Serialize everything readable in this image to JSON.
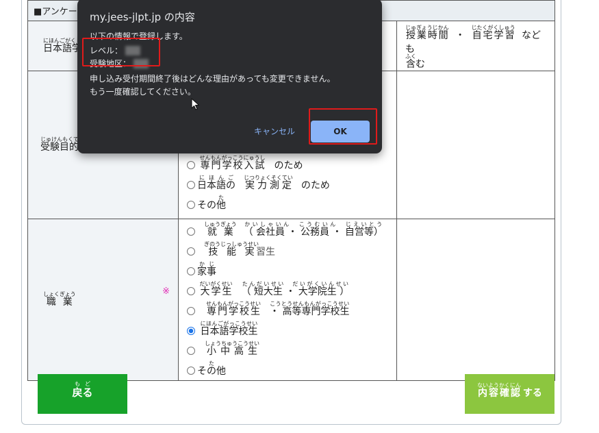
{
  "table": {
    "header_partial": "■アンケー",
    "row_japanese": {
      "label_partial": "日本語学",
      "label_ruby_partial": "にほんごがくし",
      "note": {
        "jugyojikan": "授業時間",
        "jugyojikan_ruby": "じゅぎょうじかん",
        "sep": "・",
        "jitakugakushu": "自宅学習",
        "jitakugakushu_ruby": "じたくがくしゅう",
        "nado": "なども",
        "fukumu": "含",
        "fukumu_ruby": "ふく",
        "mu": "む"
      }
    },
    "row_purpose": {
      "label_partial": "受験目的",
      "label_ruby_partial": "じゅけんもくて",
      "options": [
        {
          "text": "専門学校入試",
          "ruby": "せんもんがっこうにゅうし",
          "suffix": "のため"
        },
        {
          "prefix": "日本語の",
          "prefix_ruby": "にほんご",
          "text": "実力測定",
          "ruby": "じつりょくそくてい",
          "suffix": "のため"
        },
        {
          "text": "その",
          "suffix": "他",
          "suffix_ruby": "た"
        }
      ]
    },
    "row_occupation": {
      "label": "職業",
      "label_ruby": "しょくぎょう",
      "required_mark": "※",
      "options": [
        {
          "text": "就業",
          "ruby": "しゅうぎょう",
          "detail": "（ 会社員 ・ 公務員 ・ 自営等）",
          "detail_ruby": "かいしゃいん　こうむいん　じえいとう"
        },
        {
          "text": "技能実",
          "ruby": "ぎのうじっしゅうせい",
          "extra": "習生"
        },
        {
          "text": "家事",
          "ruby": "かじ"
        },
        {
          "text": "大学生",
          "ruby": "だいがくせい",
          "detail": "（ 短大生 ・ 大学院生 ）",
          "detail_ruby": "たんだいせい　だいがくいんせい"
        },
        {
          "text": "専門学校生",
          "ruby": "せんもんがっこうせい",
          "detail": "・ 高等専門学校生",
          "detail_ruby": "こうとうせんもんがっこうせい"
        },
        {
          "text": "日本語学校生",
          "ruby": "にほんごがっこうせい",
          "selected": true
        },
        {
          "text": "小中高生",
          "ruby": "しょうちゅうこうせい"
        },
        {
          "text": "その他",
          "ruby": "た"
        }
      ]
    }
  },
  "buttons": {
    "back": {
      "text": "戻る",
      "ruby": "もど"
    },
    "confirm": {
      "text": "内容確認",
      "ruby": "ないようかくにん",
      "suffix": "する"
    }
  },
  "dialog": {
    "title": "my.jees-jlpt.jp の内容",
    "intro": "以下の情報で登録します。",
    "level_label": "レベル：",
    "area_label": "受験地区：",
    "warning1": "申し込み受付期間終了後はどんな理由があっても変更できません。",
    "warning2": "もう一度確認してください。",
    "cancel": "キャンセル",
    "ok": "OK"
  },
  "colors": {
    "dialog_bg": "#2b2c2f",
    "ok_button": "#8ab4f8",
    "highlight_red": "#e01b1b",
    "back_button": "#17a22a",
    "confirm_button": "#8cc63f",
    "required_mark": "#e12bb4",
    "radio_selected": "#1a73e8"
  },
  "icons": {
    "cursor": "mouse-pointer-icon",
    "radio": "radio-icon"
  }
}
